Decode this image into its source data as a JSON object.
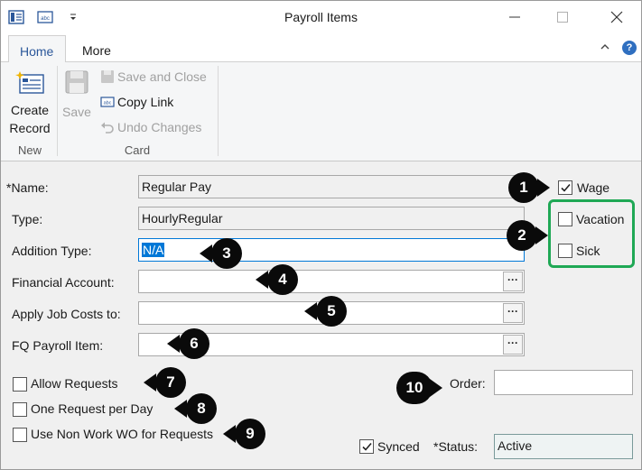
{
  "window": {
    "title": "Payroll Items"
  },
  "icons": {
    "app": "app-icon",
    "quick_access": "abbreviation-icon",
    "customize": "dropdown-arrow-icon",
    "minimize": "minimize-icon",
    "maximize": "maximize-icon",
    "close": "close-icon",
    "collapse_ribbon": "chevron-up-icon",
    "help": "help-icon"
  },
  "tabs": [
    {
      "label": "Home",
      "active": true
    },
    {
      "label": "More",
      "active": false
    }
  ],
  "ribbon": {
    "new_group": {
      "label": "New",
      "create_record": [
        "Create",
        "Record"
      ]
    },
    "card_group": {
      "label": "Card",
      "save": "Save",
      "save_and_close": "Save and Close",
      "copy_link": "Copy Link",
      "undo_changes": "Undo Changes"
    },
    "help_glyph": "?"
  },
  "form": {
    "name_label": "*Name:",
    "name_value": "Regular Pay",
    "type_label": "Type:",
    "type_value": "HourlyRegular",
    "addition_type_label": "Addition Type:",
    "addition_type_value": "N/A",
    "financial_account_label": "Financial Account:",
    "financial_account_value": "",
    "apply_job_costs_label": "Apply Job Costs to:",
    "apply_job_costs_value": "",
    "fq_payroll_item_label": "FQ Payroll Item:",
    "fq_payroll_item_value": "",
    "ellipsis": "···",
    "wage_label": "Wage",
    "wage_checked": true,
    "vacation_label": "Vacation",
    "vacation_checked": false,
    "sick_label": "Sick",
    "sick_checked": false,
    "allow_requests_label": "Allow Requests",
    "allow_requests_checked": false,
    "one_request_label": "One Request per Day",
    "one_request_checked": false,
    "non_work_wo_label": "Use Non Work WO for Requests",
    "non_work_wo_checked": false,
    "order_label": "Order:",
    "order_value": "",
    "synced_label": "Synced",
    "synced_checked": true,
    "status_label": "*Status:",
    "status_value": "Active"
  },
  "callouts": [
    "1",
    "2",
    "3",
    "4",
    "5",
    "6",
    "7",
    "8",
    "9",
    "10"
  ],
  "colors": {
    "accent": "#0078d7",
    "highlight_box": "#1fa855",
    "callout": "#0a0a0a",
    "tab_active_text": "#2b579a"
  }
}
